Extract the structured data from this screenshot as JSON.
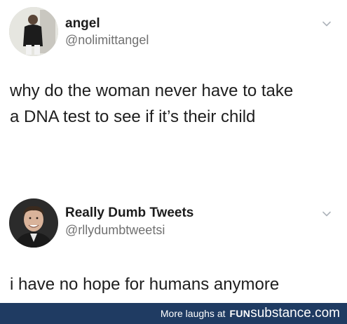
{
  "tweets": [
    {
      "name": "angel",
      "handle": "@nolimittangel",
      "lines": [
        "why do the woman never have to take",
        "a DNA test to see if it’s their child"
      ],
      "avatar_icon": "user-photo-icon",
      "menu_icon": "chevron-down-icon"
    },
    {
      "name": "Really Dumb Tweets",
      "handle": "@rllydumbtweetsi",
      "lines": [
        "i have no hope for humans anymore"
      ],
      "avatar_icon": "user-photo-icon",
      "menu_icon": "chevron-down-icon"
    }
  ],
  "footer": {
    "prefix": "More laughs at",
    "brand_part1": "FUN",
    "brand_part2": "substance",
    "brand_part3": ".com",
    "background_color": "#1f3b62"
  }
}
